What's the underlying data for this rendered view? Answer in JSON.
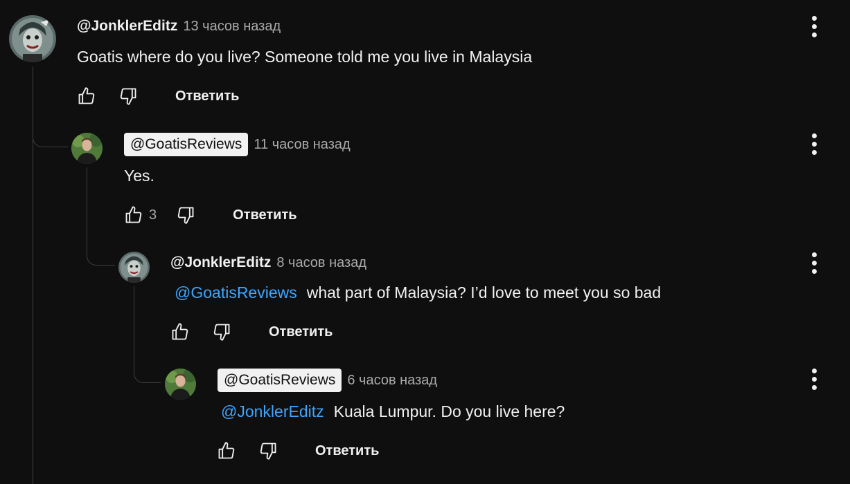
{
  "comments": [
    {
      "author": "@JonklerEditz",
      "time": "13 часов назад",
      "mention": "",
      "text": "Goatis where do you live? Someone told me you live in Malaysia",
      "likes": "",
      "reply_label": "Ответить",
      "avatar_icon": "joker-avatar"
    },
    {
      "author": "@GoatisReviews",
      "time": "11 часов назад",
      "mention": "",
      "text": "Yes.",
      "likes": "3",
      "reply_label": "Ответить",
      "avatar_icon": "man-avatar"
    },
    {
      "author": "@JonklerEditz",
      "time": "8 часов назад",
      "mention": "@GoatisReviews",
      "text": "what part of Malaysia? I’d love to meet you so bad",
      "likes": "",
      "reply_label": "Ответить",
      "avatar_icon": "joker-avatar"
    },
    {
      "author": "@GoatisReviews",
      "time": "6 часов назад",
      "mention": "@JonklerEditz",
      "text": "Kuala Lumpur. Do you live here?",
      "likes": "",
      "reply_label": "Ответить",
      "avatar_icon": "man-avatar"
    }
  ],
  "colors": {
    "background": "#0f0f0f",
    "text": "#f1f1f1",
    "secondary": "#aaaaaa",
    "mention": "#3ea6ff",
    "thread_line": "#3f3f3f"
  }
}
